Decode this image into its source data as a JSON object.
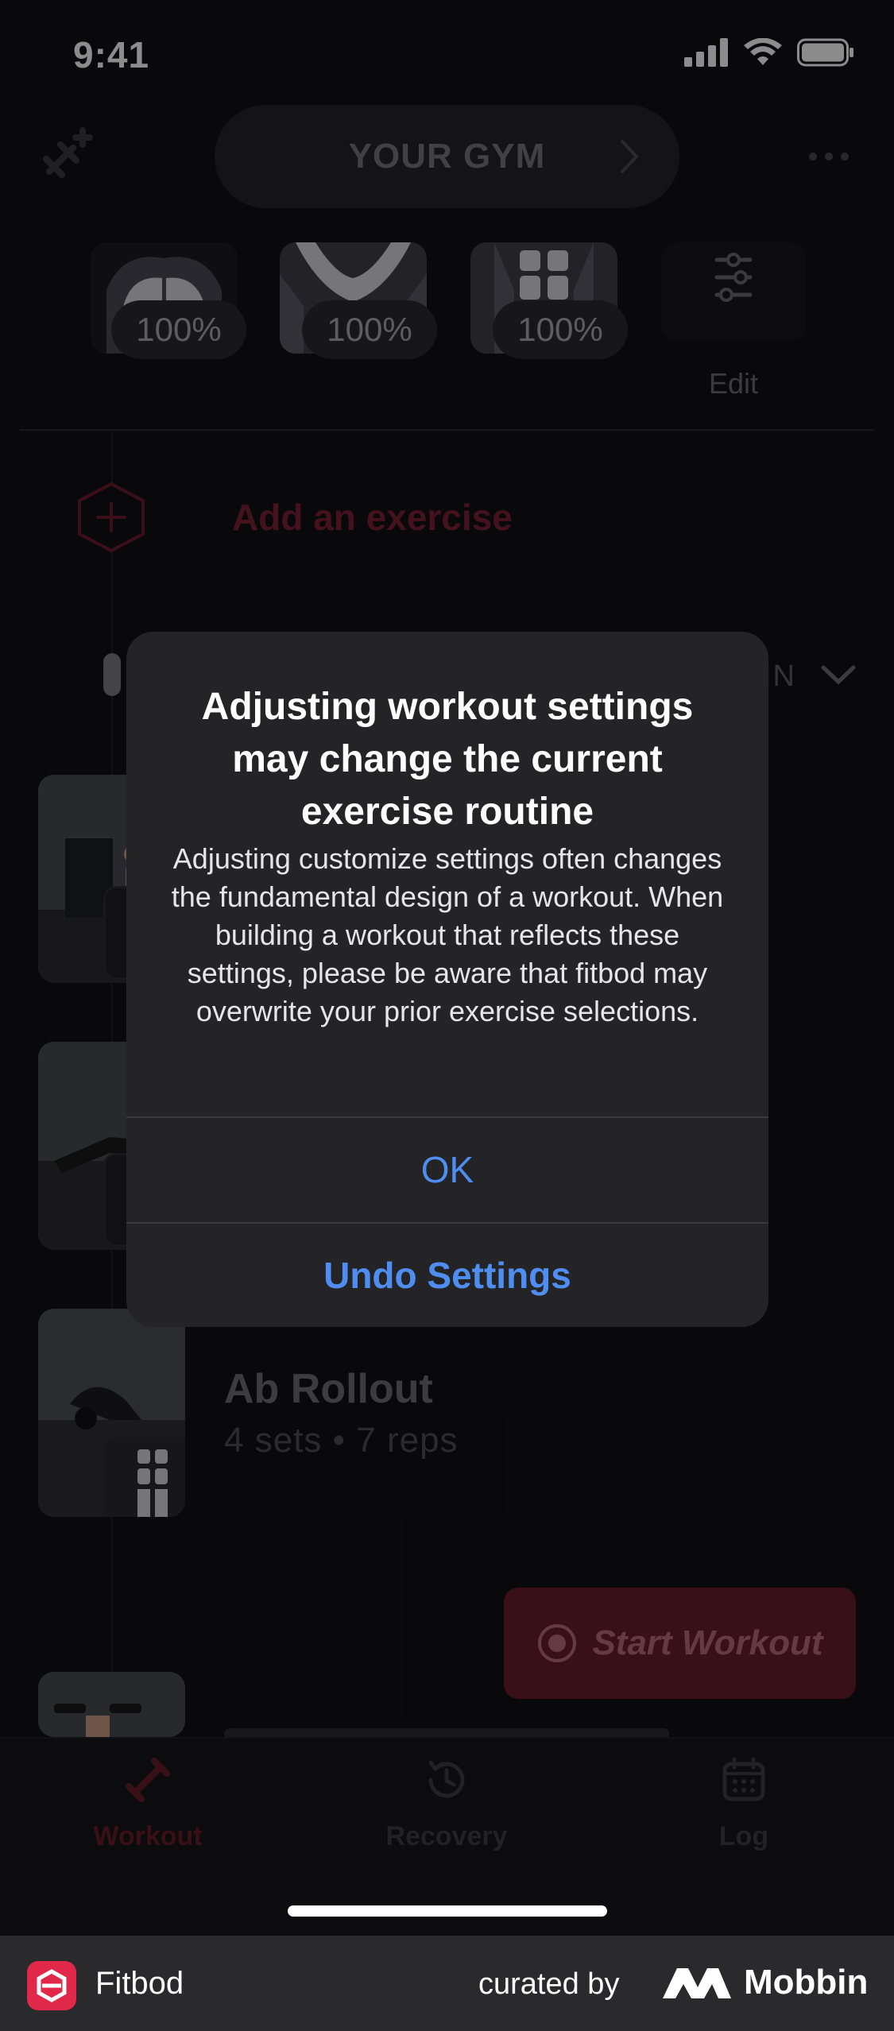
{
  "status_bar": {
    "time": "9:41"
  },
  "header": {
    "gym_label": "YOUR GYM"
  },
  "muscles": [
    {
      "percent": "100%"
    },
    {
      "percent": "100%"
    },
    {
      "percent": "100%"
    }
  ],
  "edit_label": "Edit",
  "add_exercise_label": "Add an exercise",
  "sort_label": "IN",
  "exercise": {
    "name": "Ab Rollout",
    "sets": "4 sets • 7 reps"
  },
  "start_workout_label": "Start Workout",
  "tabs": [
    {
      "label": "Workout",
      "color": "#6b1e2b"
    },
    {
      "label": "Recovery",
      "color": "#3e3d43"
    },
    {
      "label": "Log",
      "color": "#3e3d43"
    }
  ],
  "alert": {
    "title": "Adjusting workout settings may change the current exercise routine",
    "message": "Adjusting customize settings often changes the fundamental design of a workout. When building a workout that reflects these settings, please be aware that fitbod may overwrite your prior exercise selections.",
    "ok_label": "OK",
    "undo_label": "Undo Settings"
  },
  "footer": {
    "app_name": "Fitbod",
    "curated_by": "curated by",
    "brand": "Mobbin"
  },
  "colors": {
    "accent": "#e0294a",
    "link_blue": "#4f8ef0",
    "background": "#121116"
  }
}
